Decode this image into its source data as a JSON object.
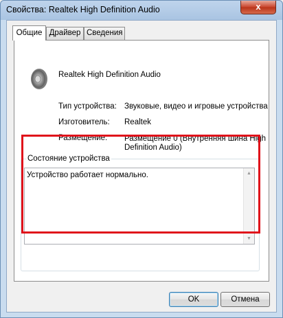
{
  "window": {
    "title": "Свойства: Realtek High Definition Audio",
    "close_label": "x"
  },
  "tabs": [
    {
      "label": "Общие",
      "active": true
    },
    {
      "label": "Драйвер",
      "active": false
    },
    {
      "label": "Сведения",
      "active": false
    }
  ],
  "device": {
    "name": "Realtek High Definition Audio",
    "icon": "speaker-icon"
  },
  "properties": [
    {
      "label": "Тип устройства:",
      "value": "Звуковые, видео и игровые устройства"
    },
    {
      "label": "Изготовитель:",
      "value": "Realtek"
    },
    {
      "label": "Размещение:",
      "value_line1": "Размещение 0 (Внутренняя шина High",
      "value_line2": "Definition Audio)"
    }
  ],
  "status": {
    "group_label": "Состояние устройства",
    "text": "Устройство работает нормально.",
    "highlight_color": "#e0101a"
  },
  "buttons": {
    "ok": "OK",
    "cancel": "Отмена"
  }
}
